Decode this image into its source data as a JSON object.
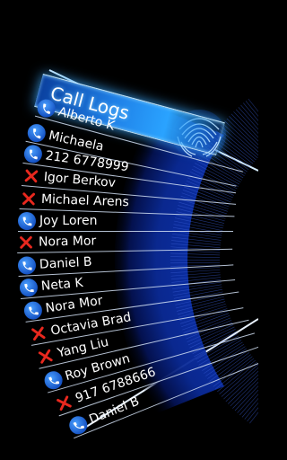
{
  "header": {
    "title": "Call Logs"
  },
  "icons": {
    "fingerprint": "fingerprint-icon",
    "call": "phone-icon",
    "missed": "missed-call-x-icon"
  },
  "colors": {
    "accent": "#1f7fe6",
    "missed": "#e8281e",
    "arc": "#0b2fa8"
  },
  "calls": [
    {
      "name": "Alberto K",
      "status": "call"
    },
    {
      "name": "Michaela",
      "status": "call"
    },
    {
      "name": "212 6778999",
      "status": "call"
    },
    {
      "name": "Igor Berkov",
      "status": "missed"
    },
    {
      "name": "Michael Arens",
      "status": "missed"
    },
    {
      "name": "Joy Loren",
      "status": "call"
    },
    {
      "name": "Nora Mor",
      "status": "missed"
    },
    {
      "name": "Daniel B",
      "status": "call"
    },
    {
      "name": "Neta K",
      "status": "call"
    },
    {
      "name": "Nora Mor",
      "status": "call"
    },
    {
      "name": "Octavia Brad",
      "status": "missed"
    },
    {
      "name": "Yang Liu",
      "status": "missed"
    },
    {
      "name": "Roy Brown",
      "status": "call"
    },
    {
      "name": "917 6788666",
      "status": "missed"
    },
    {
      "name": "Daniel B",
      "status": "call"
    }
  ]
}
